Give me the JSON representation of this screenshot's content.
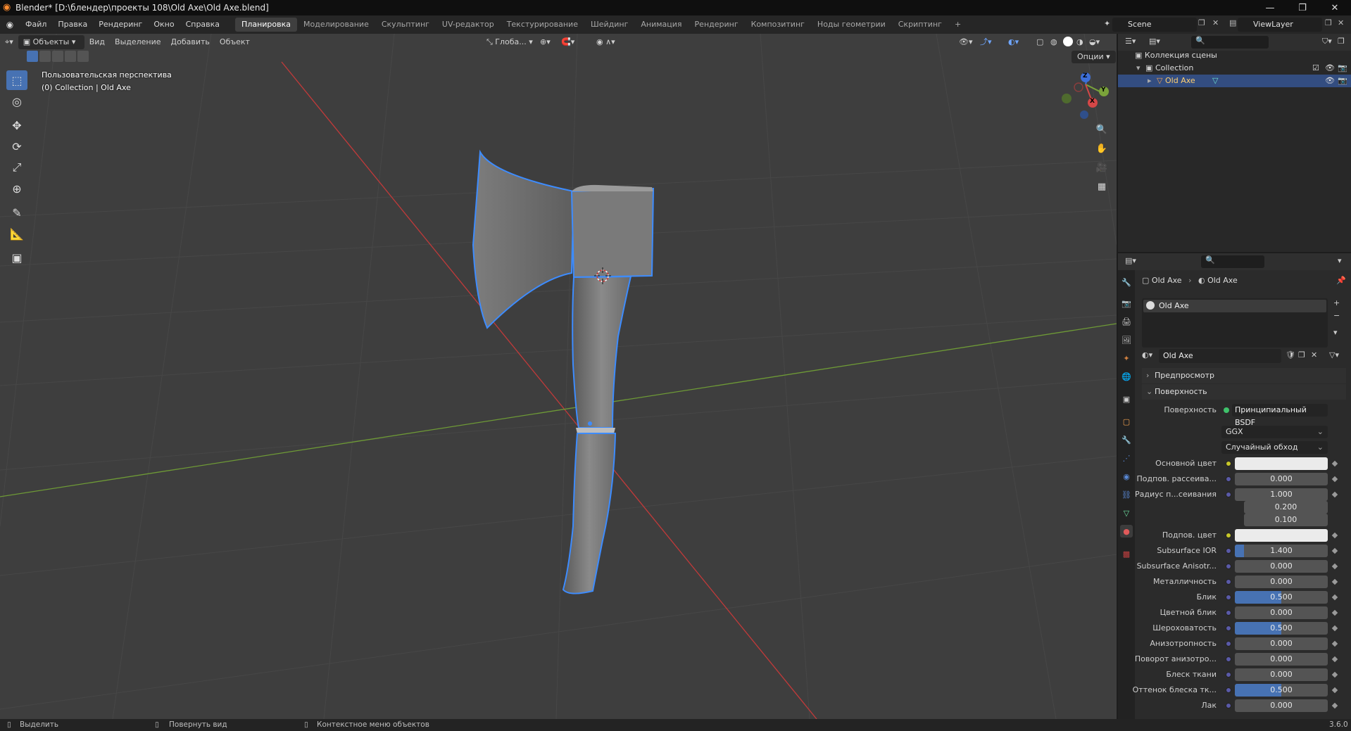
{
  "titlebar": {
    "title": "Blender* [D:\\блендер\\проекты 108\\Old Axe\\Old Axe.blend]",
    "minimize": "—",
    "maximize": "❐",
    "close": "✕"
  },
  "menu": [
    "Файл",
    "Правка",
    "Рендеринг",
    "Окно",
    "Справка"
  ],
  "workspaces": [
    "Планировка",
    "Моделирование",
    "Скульптинг",
    "UV-редактор",
    "Текстурирование",
    "Шейдинг",
    "Анимация",
    "Рендеринг",
    "Композитинг",
    "Ноды геометрии",
    "Скриптинг",
    "+"
  ],
  "active_workspace": "Планировка",
  "scene": {
    "name": "Scene",
    "view_layer": "ViewLayer"
  },
  "viewport": {
    "mode": "Объекты",
    "menu": [
      "Вид",
      "Выделение",
      "Добавить",
      "Объект"
    ],
    "transform": "Глоба...",
    "options": "Опции",
    "overlay_line1": "Пользовательская перспектива",
    "overlay_line2": "(0) Collection | Old Axe",
    "gizmo_z": "Z",
    "gizmo_y": "Y",
    "gizmo_x": "X"
  },
  "outliner": {
    "root": "Коллекция сцены",
    "collection": "Collection",
    "object": "Old Axe"
  },
  "properties": {
    "breadcrumb_object": "Old Axe",
    "breadcrumb_material": "Old Axe",
    "slot_name": "Old Axe",
    "material_name": "Old Axe",
    "panel_preview": "Предпросмотр",
    "panel_surface": "Поверхность",
    "surface_label": "Поверхность",
    "surface_value": "Принципиальный BSDF",
    "distribution": "GGX",
    "subsurface_method": "Случайный обход",
    "rows": [
      {
        "label": "Основной цвет",
        "type": "color"
      },
      {
        "label": "Подпов. рассеива...",
        "value": "0.000",
        "fill": 0
      },
      {
        "label": "Радиус п...сеивания",
        "value": "1.000",
        "fill": 0
      },
      {
        "label": "",
        "value": "0.200",
        "fill": 0
      },
      {
        "label": "",
        "value": "0.100",
        "fill": 0
      },
      {
        "label": "Подпов. цвет",
        "type": "color"
      },
      {
        "label": "Subsurface IOR",
        "value": "1.400",
        "fill": 0.1
      },
      {
        "label": "Subsurface Anisotr...",
        "value": "0.000",
        "fill": 0
      },
      {
        "label": "Металличность",
        "value": "0.000",
        "fill": 0
      },
      {
        "label": "Блик",
        "value": "0.500",
        "fill": 0.5
      },
      {
        "label": "Цветной блик",
        "value": "0.000",
        "fill": 0
      },
      {
        "label": "Шероховатость",
        "value": "0.500",
        "fill": 0.5
      },
      {
        "label": "Анизотропность",
        "value": "0.000",
        "fill": 0
      },
      {
        "label": "Поворот анизотро...",
        "value": "0.000",
        "fill": 0
      },
      {
        "label": "Блеск ткани",
        "value": "0.000",
        "fill": 0
      },
      {
        "label": "Оттенок блеска тк...",
        "value": "0.500",
        "fill": 0.5
      },
      {
        "label": "Лак",
        "value": "0.000",
        "fill": 0
      }
    ]
  },
  "statusbar": {
    "select": "Выделить",
    "rotate": "Повернуть вид",
    "context": "Контекстное меню объектов",
    "version": "3.6.0"
  },
  "colors": {
    "accent": "#4772b3",
    "selection": "#334d80",
    "outline": "#3d8cff",
    "axis_x": "#c23a3a",
    "axis_y": "#6e9a36"
  }
}
